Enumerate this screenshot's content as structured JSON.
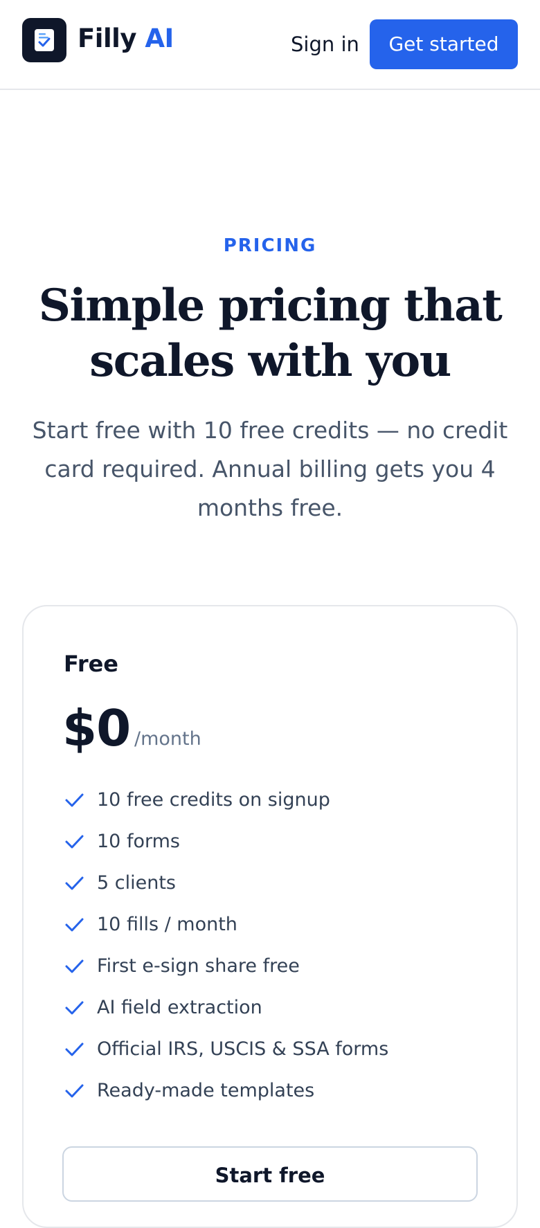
{
  "header": {
    "brand_name": "Filly",
    "brand_suffix": "AI",
    "logo_icon": "document-check-icon",
    "sign_in_label": "Sign in",
    "get_started_label": "Get started"
  },
  "hero": {
    "eyebrow": "PRICING",
    "title": "Simple pricing that scales with you",
    "subtitle": "Start free with 10 free credits — no credit card required. Annual billing gets you 4 months free."
  },
  "plan": {
    "name": "Free",
    "price": "$0",
    "period": "/month",
    "features": [
      "10 free credits on signup",
      "10 forms",
      "5 clients",
      "10 fills / month",
      "First e-sign share free",
      "AI field extraction",
      "Official IRS, USCIS & SSA forms",
      "Ready-made templates"
    ],
    "cta_label": "Start free"
  },
  "colors": {
    "accent": "#2563eb",
    "dark": "#0f172a",
    "muted": "#475569"
  }
}
